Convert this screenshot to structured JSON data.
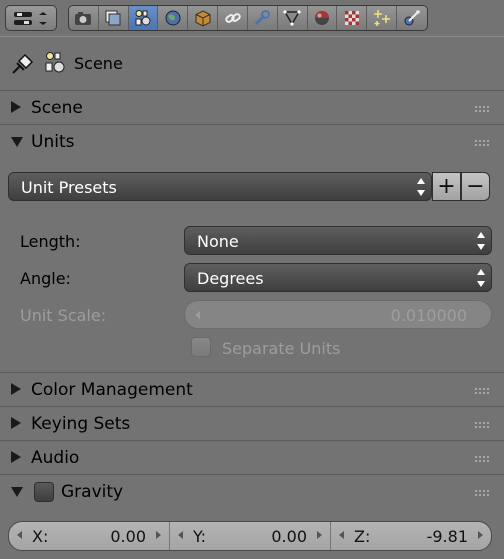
{
  "toolbar": {
    "editor_type_icon": "properties-editor-icon",
    "tabs": [
      {
        "icon": "render-camera-icon",
        "active": false
      },
      {
        "icon": "render-layers-icon",
        "active": false
      },
      {
        "icon": "scene-icon",
        "active": true
      },
      {
        "icon": "world-icon",
        "active": false
      },
      {
        "icon": "object-cube-icon",
        "active": false
      },
      {
        "icon": "constraints-chain-icon",
        "active": false
      },
      {
        "icon": "modifiers-wrench-icon",
        "active": false
      },
      {
        "icon": "object-data-icon",
        "active": false
      },
      {
        "icon": "material-icon",
        "active": false
      },
      {
        "icon": "texture-icon",
        "active": false
      },
      {
        "icon": "particles-icon",
        "active": false
      },
      {
        "icon": "physics-icon",
        "active": false
      }
    ]
  },
  "context": {
    "label": "Scene"
  },
  "panels": {
    "scene": {
      "title": "Scene",
      "expanded": false
    },
    "units": {
      "title": "Units",
      "expanded": true,
      "presets_label": "Unit Presets",
      "add_symbol": "+",
      "remove_symbol": "−",
      "length_label": "Length:",
      "length_value": "None",
      "angle_label": "Angle:",
      "angle_value": "Degrees",
      "scale_label": "Unit Scale:",
      "scale_value": "0.010000",
      "separate_label": "Separate Units"
    },
    "color_management": {
      "title": "Color Management",
      "expanded": false
    },
    "keying_sets": {
      "title": "Keying Sets",
      "expanded": false
    },
    "audio": {
      "title": "Audio",
      "expanded": false
    },
    "gravity": {
      "title": "Gravity",
      "expanded": true,
      "x_label": "X:",
      "x_value": "0.00",
      "y_label": "Y:",
      "y_value": "0.00",
      "z_label": "Z:",
      "z_value": "-9.81"
    }
  },
  "colors": {
    "active_tab": "#4a74b3",
    "panel_bg": "#737373",
    "dropdown_bg": "#474747"
  }
}
